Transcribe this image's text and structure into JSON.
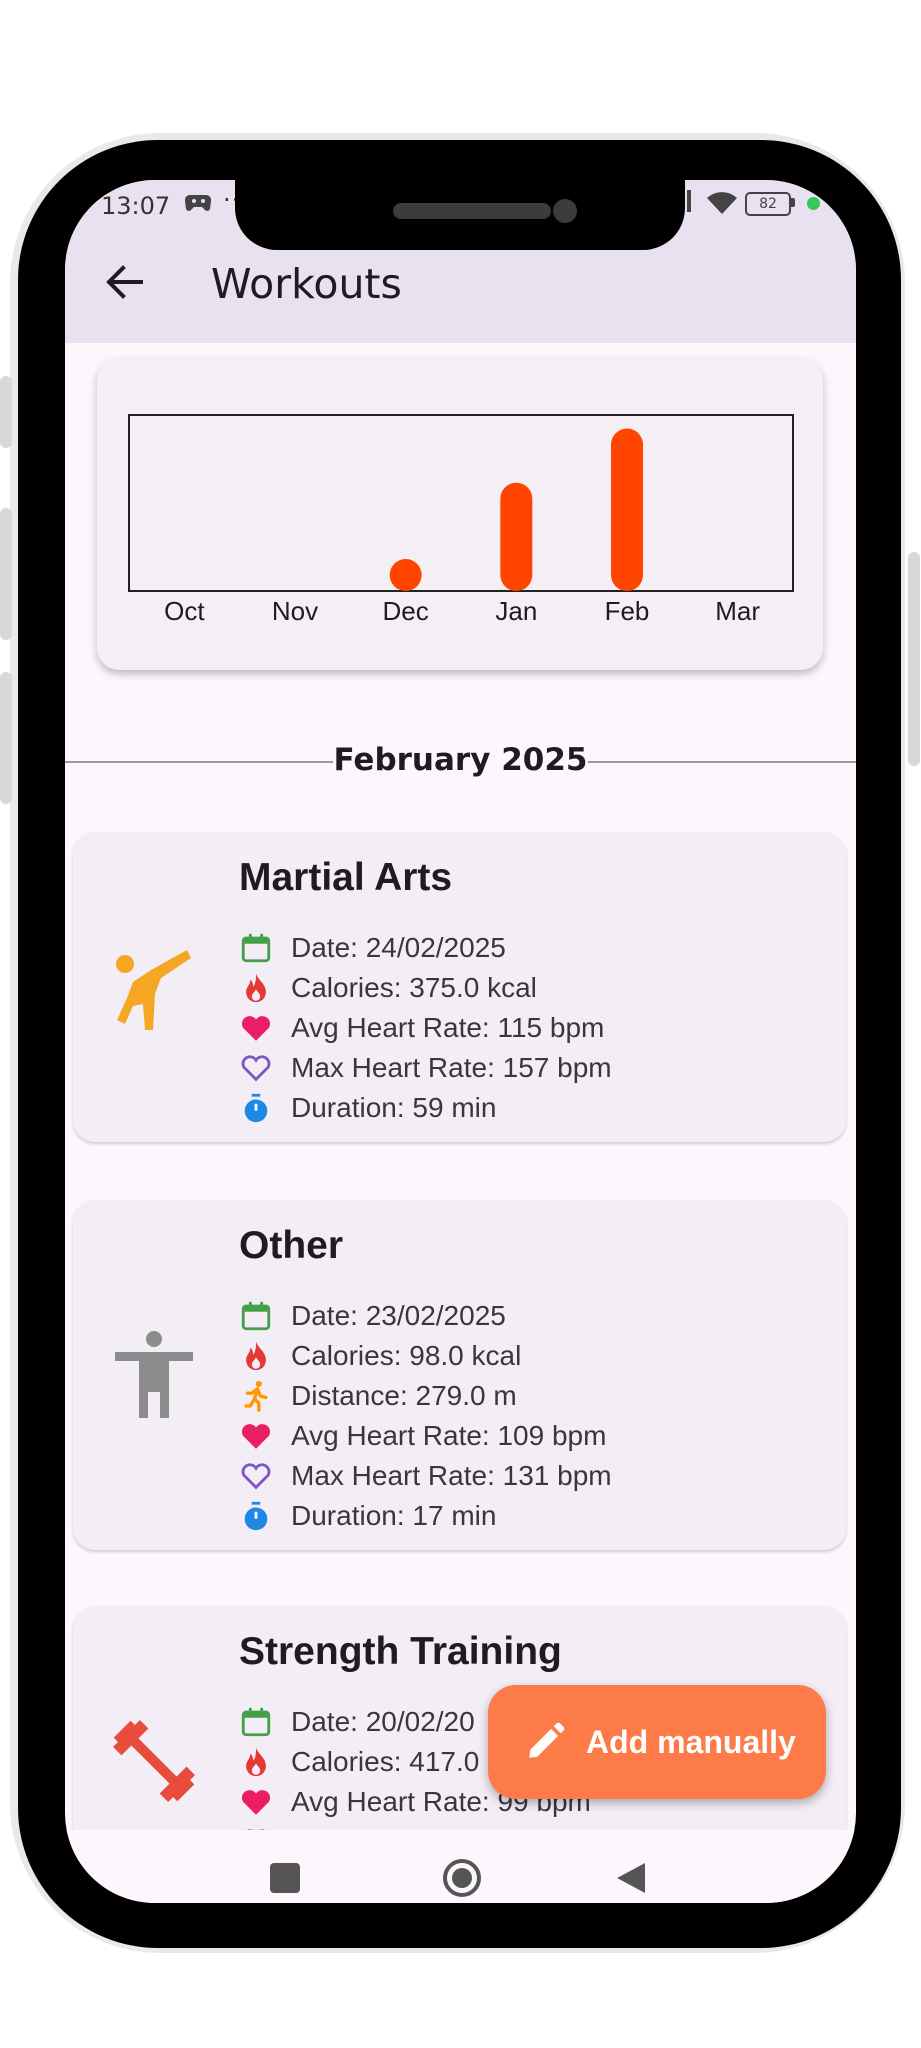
{
  "status_bar": {
    "time": "13:07",
    "extra": "··",
    "battery": "82"
  },
  "app_bar": {
    "title": "Workouts"
  },
  "chart_data": {
    "type": "bar",
    "categories": [
      "Oct",
      "Nov",
      "Dec",
      "Jan",
      "Feb",
      "Mar"
    ],
    "values": [
      0,
      0,
      1,
      4,
      6,
      0
    ],
    "title": "",
    "xlabel": "",
    "ylabel": "",
    "ylim": [
      0,
      6.5
    ],
    "bar_color": "#ff4500",
    "grid": false
  },
  "month_header": "February 2025",
  "workouts": [
    {
      "title": "Martial Arts",
      "icon": "martial-arts-icon",
      "date": "Date: 24/02/2025",
      "calories": "Calories: 375.0 kcal",
      "avg_hr": "Avg Heart Rate: 115 bpm",
      "max_hr": "Max Heart Rate: 157 bpm",
      "duration": "Duration: 59 min"
    },
    {
      "title": "Other",
      "icon": "person-icon",
      "date": "Date: 23/02/2025",
      "calories": "Calories: 98.0 kcal",
      "distance": "Distance: 279.0 m",
      "avg_hr": "Avg Heart Rate: 109 bpm",
      "max_hr": "Max Heart Rate: 131 bpm",
      "duration": "Duration: 17 min"
    },
    {
      "title": "Strength Training",
      "icon": "dumbbell-icon",
      "date": "Date: 20/02/20",
      "calories": "Calories: 417.0",
      "avg_hr": "Avg Heart Rate: 99 bpm"
    }
  ],
  "fab": {
    "label": "Add manually",
    "color": "#fc7b48"
  },
  "colors": {
    "calendar": "#43a047",
    "fire": "#e53935",
    "heart": "#e91e63",
    "heart_outline": "#7e57c2",
    "timer": "#1e88e5",
    "run": "#ff9800",
    "martial": "#f5a623",
    "person": "#8c8c8c",
    "dumbbell": "#e84c3d"
  }
}
